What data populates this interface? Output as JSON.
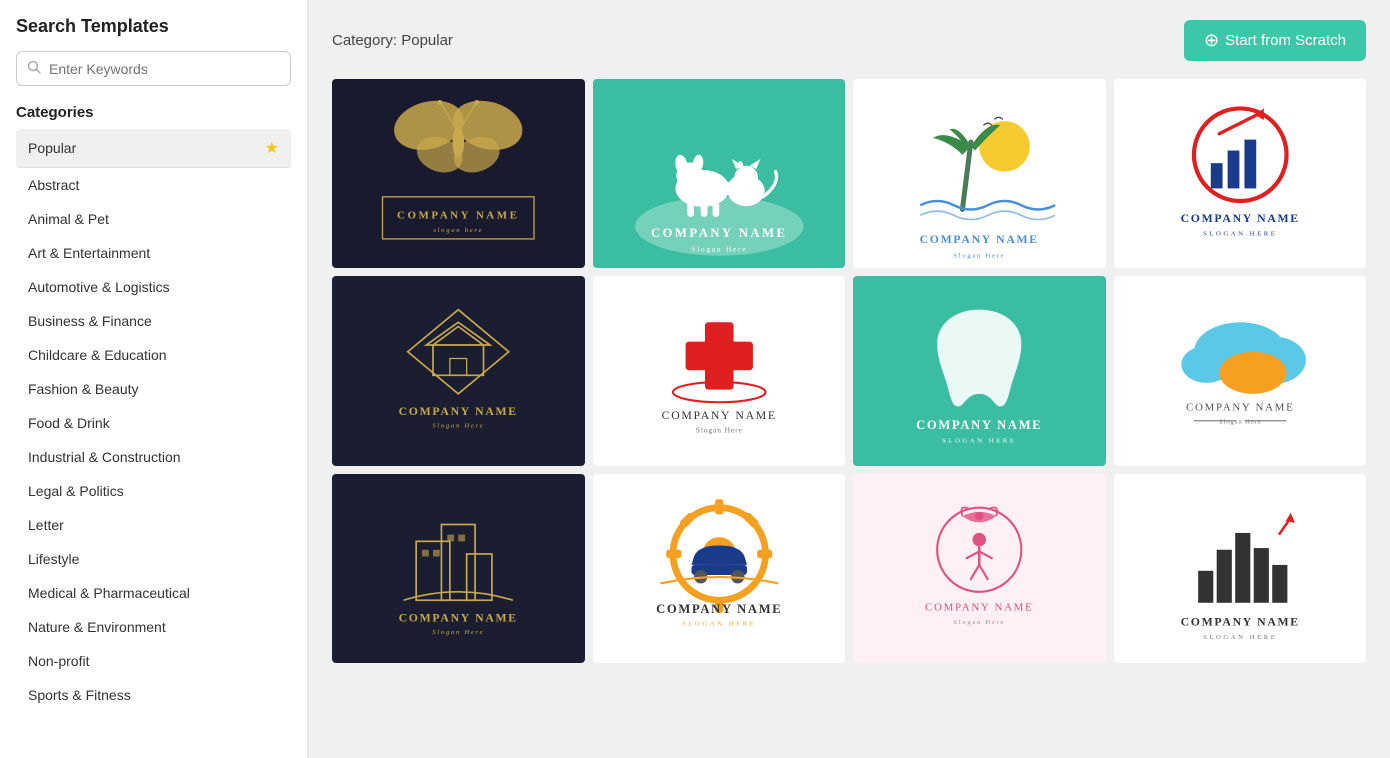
{
  "sidebar": {
    "title": "Search Templates",
    "search_placeholder": "Enter Keywords",
    "categories_title": "Categories",
    "categories": [
      {
        "id": "popular",
        "label": "Popular",
        "active": true,
        "star": true
      },
      {
        "id": "abstract",
        "label": "Abstract",
        "active": false
      },
      {
        "id": "animal-pet",
        "label": "Animal & Pet",
        "active": false
      },
      {
        "id": "art-entertainment",
        "label": "Art & Entertainment",
        "active": false
      },
      {
        "id": "automotive-logistics",
        "label": "Automotive & Logistics",
        "active": false
      },
      {
        "id": "business-finance",
        "label": "Business & Finance",
        "active": false
      },
      {
        "id": "childcare-education",
        "label": "Childcare & Education",
        "active": false
      },
      {
        "id": "fashion-beauty",
        "label": "Fashion & Beauty",
        "active": false
      },
      {
        "id": "food-drink",
        "label": "Food & Drink",
        "active": false
      },
      {
        "id": "industrial-construction",
        "label": "Industrial & Construction",
        "active": false
      },
      {
        "id": "legal-politics",
        "label": "Legal & Politics",
        "active": false
      },
      {
        "id": "letter",
        "label": "Letter",
        "active": false
      },
      {
        "id": "lifestyle",
        "label": "Lifestyle",
        "active": false
      },
      {
        "id": "medical-pharmaceutical",
        "label": "Medical & Pharmaceutical",
        "active": false
      },
      {
        "id": "nature-environment",
        "label": "Nature & Environment",
        "active": false
      },
      {
        "id": "non-profit",
        "label": "Non-profit",
        "active": false
      },
      {
        "id": "sports-fitness",
        "label": "Sports & Fitness",
        "active": false
      }
    ]
  },
  "main": {
    "category_prefix": "Category",
    "category_name": "Popular",
    "start_button_label": "Start from Scratch"
  }
}
